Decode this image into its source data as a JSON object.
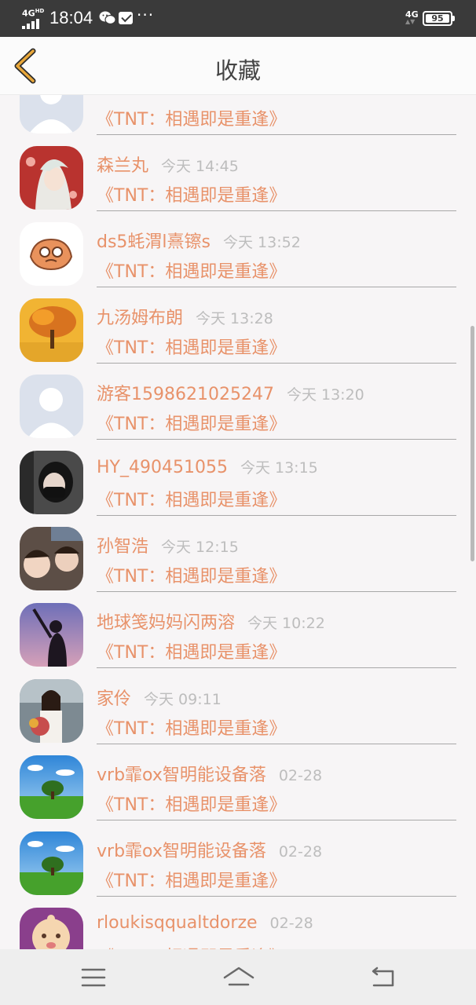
{
  "status_bar": {
    "network_left": "4G",
    "network_left_sup": "HD",
    "time": "18:04",
    "icons": [
      "signal-icon",
      "wechat-icon",
      "message-icon",
      "more-dots-icon",
      "signal-4g-icon",
      "battery-icon"
    ],
    "network_right": "4G",
    "battery": "95"
  },
  "header": {
    "title": "收藏",
    "back_icon": "chevron-left-icon",
    "accent_color": "#e8a73a"
  },
  "list": {
    "items": [
      {
        "name": "",
        "time": "",
        "subtitle": "《TNT：相遇即是重逢》",
        "avatar": "avatar-default"
      },
      {
        "name": "森兰丸",
        "time": "今天 14:45",
        "subtitle": "《TNT：相遇即是重逢》",
        "avatar": "avatar-anime"
      },
      {
        "name": "ds5蚝渭l熹镲s",
        "time": "今天 13:52",
        "subtitle": "《TNT：相遇即是重逢》",
        "avatar": "avatar-cartoon"
      },
      {
        "name": "九汤姆布朗",
        "time": "今天 13:28",
        "subtitle": "《TNT：相遇即是重逢》",
        "avatar": "avatar-autumn-tree"
      },
      {
        "name": "游客1598621025247",
        "time": "今天 13:20",
        "subtitle": "《TNT：相遇即是重逢》",
        "avatar": "avatar-default"
      },
      {
        "name": "HY_490451055",
        "time": "今天 13:15",
        "subtitle": "《TNT：相遇即是重逢》",
        "avatar": "avatar-masked-person"
      },
      {
        "name": "孙智浩",
        "time": "今天 12:15",
        "subtitle": "《TNT：相遇即是重逢》",
        "avatar": "avatar-two-people"
      },
      {
        "name": "地球笺妈妈闪两溶",
        "time": "今天 10:22",
        "subtitle": "《TNT：相遇即是重逢》",
        "avatar": "avatar-silhouette"
      },
      {
        "name": "家伶",
        "time": "今天 09:11",
        "subtitle": "《TNT：相遇即是重逢》",
        "avatar": "avatar-girl-flowers"
      },
      {
        "name": "vrb霏ox智明能设备落",
        "time": "02-28",
        "subtitle": "《TNT：相遇即是重逢》",
        "avatar": "avatar-landscape"
      },
      {
        "name": "vrb霏ox智明能设备落",
        "time": "02-28",
        "subtitle": "《TNT：相遇即是重逢》",
        "avatar": "avatar-landscape"
      },
      {
        "name": "rloukisqqualtdorze",
        "time": "02-28",
        "subtitle": "《TNT：相遇即是重逢》",
        "avatar": "avatar-baby"
      }
    ]
  },
  "nav_bar": {
    "icons": [
      "menu-icon",
      "home-icon",
      "back-icon"
    ]
  }
}
